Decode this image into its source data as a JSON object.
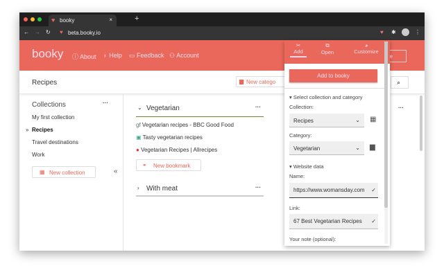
{
  "browser": {
    "tab_title": "booky",
    "url": "beta.booky.io"
  },
  "header": {
    "logo": "booky",
    "nav": [
      "About",
      "Help",
      "Feedback",
      "Account"
    ],
    "customize_partial": "mize"
  },
  "subheader": {
    "title": "Recipes",
    "new_category_label": "New catego"
  },
  "sidebar": {
    "title": "Collections",
    "items": [
      {
        "label": "My first collection",
        "active": false
      },
      {
        "label": "Recipes",
        "active": true
      },
      {
        "label": "Travel destinations",
        "active": false
      },
      {
        "label": "Work",
        "active": false
      }
    ],
    "new_collection_label": "New collection"
  },
  "categories": [
    {
      "title": "Vegetarian",
      "expanded": true,
      "bookmarks": [
        "Vegetarian recipes - BBC Good Food",
        "Tasty vegetarian recipes",
        "Vegetarian Recipes | Allrecipes"
      ],
      "new_bookmark_label": "New bookmark"
    },
    {
      "title": "With meat",
      "expanded": false
    }
  ],
  "popup": {
    "tabs": [
      "Add",
      "Open",
      "Customize"
    ],
    "add_button": "Add to booky",
    "section1": "Select collection and category",
    "collection_label": "Collection:",
    "collection_value": "Recipes",
    "category_label": "Category:",
    "category_value": "Vegetarian",
    "section2": "Website data",
    "name_label": "Name:",
    "name_value": "https://www.womansday.com",
    "link_label": "Link:",
    "link_value": "67 Best Vegetarian Recipes",
    "note_label": "Your note (optional):"
  },
  "colors": {
    "brand": "#e9685b"
  }
}
